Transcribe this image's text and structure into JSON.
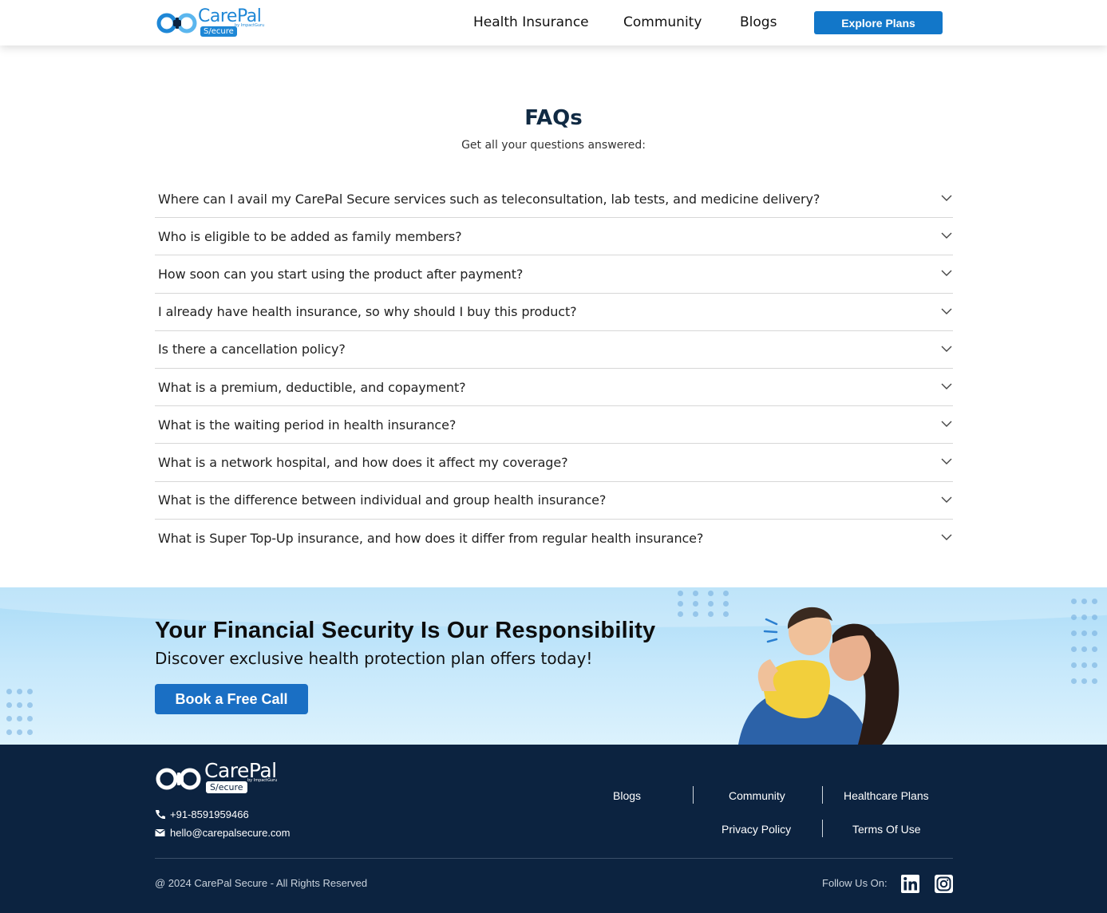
{
  "header": {
    "logo": {
      "name": "CarePal",
      "badge": "S/ecure",
      "by": "by ImpactGuru"
    },
    "nav": [
      "Health Insurance",
      "Community",
      "Blogs"
    ],
    "cta": "Explore Plans",
    "colors": {
      "brand": "#1e87d6",
      "cta_bg": "#1277c9"
    }
  },
  "faq": {
    "title": "FAQs",
    "subtitle": "Get all your questions answered:",
    "items": [
      "Where can I avail my CarePal Secure services such as teleconsultation, lab tests, and medicine delivery?",
      "Who is eligible to be added as family members?",
      "How soon can you start using the product after payment?",
      "I already have health insurance, so why should I buy this product?",
      "Is there a cancellation policy?",
      "What is a premium, deductible, and copayment?",
      "What is the waiting period in health insurance?",
      "What is a network hospital, and how does it affect my coverage?",
      "What is the difference between individual and group health insurance?",
      "What is Super Top-Up insurance, and how does it differ from regular health insurance?"
    ],
    "icon": "chevron-down-icon"
  },
  "banner": {
    "title": "Your Financial Security Is Our Responsibility",
    "subtitle": "Discover exclusive health protection plan offers today!",
    "cta": "Book a Free Call",
    "image": "mother-and-child-photo"
  },
  "footer": {
    "logo": {
      "name": "CarePal",
      "badge": "S/ecure",
      "by": "by ImpactGuru"
    },
    "phone": "+91-8591959466",
    "email": "hello@carepalsecure.com",
    "links_row1": [
      "Blogs",
      "Community",
      "Healthcare Plans"
    ],
    "links_row2": [
      "Privacy Policy",
      "Terms Of Use"
    ],
    "copyright": "@ 2024 CarePal Secure - All Rights Reserved",
    "follow": "Follow Us On:",
    "social": [
      "linkedin-icon",
      "instagram-icon"
    ],
    "colors": {
      "bg": "#0c2340"
    }
  }
}
